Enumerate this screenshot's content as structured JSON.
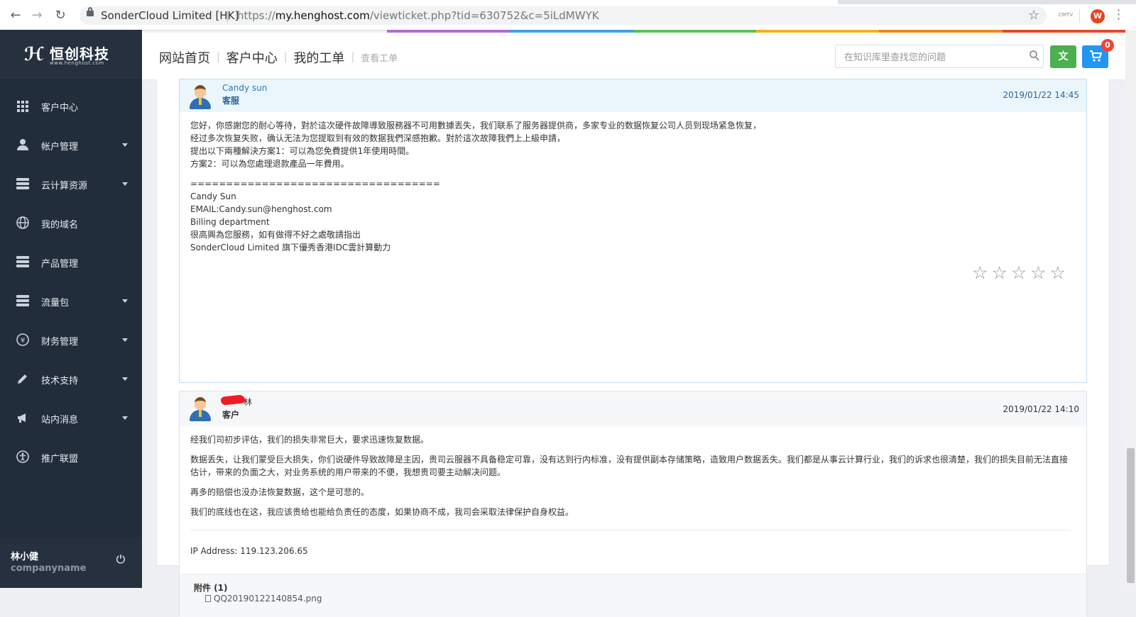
{
  "browser": {
    "site_identity": "SonderCloud Limited [HK]",
    "url_scheme": "https://",
    "url_host": "my.henghost.com",
    "url_path": "/viewticket.php?tid=630752&c=5iLdMWYK",
    "ext_label": "CMTV",
    "profile_initial": "W"
  },
  "rainbow_colors": [
    "#b36ad1",
    "#3fa0e6",
    "#5cc15c",
    "#f5b21b",
    "#f0851c",
    "#e3492a"
  ],
  "sidebar": {
    "logo_text": "恒创科技",
    "logo_sub": "www.henghost.com",
    "items": [
      {
        "label": "客户中心",
        "icon": "grid-icon",
        "has_submenu": false
      },
      {
        "label": "帐户管理",
        "icon": "user-icon",
        "has_submenu": true
      },
      {
        "label": "云计算资源",
        "icon": "server-icon",
        "has_submenu": true
      },
      {
        "label": "我的域名",
        "icon": "globe-icon",
        "has_submenu": false
      },
      {
        "label": "产品管理",
        "icon": "server-icon",
        "has_submenu": false
      },
      {
        "label": "流量包",
        "icon": "server-icon",
        "has_submenu": true
      },
      {
        "label": "财务管理",
        "icon": "yen-icon",
        "has_submenu": true
      },
      {
        "label": "技术支持",
        "icon": "pencil-icon",
        "has_submenu": true
      },
      {
        "label": "站内消息",
        "icon": "megaphone-icon",
        "has_submenu": true
      },
      {
        "label": "推广联盟",
        "icon": "accessibility-icon",
        "has_submenu": false
      }
    ],
    "user": {
      "name": "林小健",
      "company": "companyname"
    }
  },
  "header": {
    "breadcrumb": [
      "网站首页",
      "客户中心",
      "我的工单",
      "查看工单"
    ],
    "search_placeholder": "在知识库里查找您的问题",
    "cart_count": "0"
  },
  "replies": [
    {
      "type": "staff",
      "name": "Candy sun",
      "role": "客服",
      "date": "2019/01/22 14:45",
      "lines": [
        "您好，你感謝您的耐心等待，對於這次硬件故障導致服務器不可用數據丟失，我们联系了服务器提供商，多家专业的数据恢复公司人员到现场紧急恢复，",
        "经过多次恢复失败，确认无法为您提取到有效的数据我們深感抱歉。對於這次故障我們上上級申請，",
        "提出以下兩種解決方案1：可以為您免費提供1年使用時間。",
        "方案2：可以為您處理退款產品一年費用。"
      ],
      "signature": [
        "===================================",
        "Candy Sun",
        "EMAIL:Candy.sun@henghost.com",
        "Billing department",
        "很高興為您服務，如有做得不好之處敬請指出",
        "SonderCloud Limited 旗下優秀香港IDC雲計算動力"
      ],
      "rating_stars": "☆☆☆☆☆"
    },
    {
      "type": "client",
      "name": "林",
      "role": "客户",
      "date": "2019/01/22 14:10",
      "paragraphs": [
        "经我们司初步评估，我们的损失非常巨大，要求迅速恢复数据。",
        "数据丢失，让我们蒙受巨大损失，你们说硬件导致故障是主因，贵司云服器不具备稳定可靠，没有达到行内标准，没有提供副本存储策略，造致用户数据丢失。我们都是从事云计算行业，我们的诉求也很清楚，我们的损失目前无法直接估计，带来的负面之大，对业务系统的用户带来的不便，我想贵司要主动解决问题。",
        "再多的赔偿也没办法恢复数据，这个是可悲的。",
        "我们的底线也在这，我应该贵给也能给负责任的态度，如果协商不成，我司会采取法律保护自身权益。"
      ],
      "ip_address": "IP Address: 119.123.206.65",
      "attachments_title": "附件 (1)",
      "attachment_file": "QQ20190122140854.png"
    }
  ]
}
